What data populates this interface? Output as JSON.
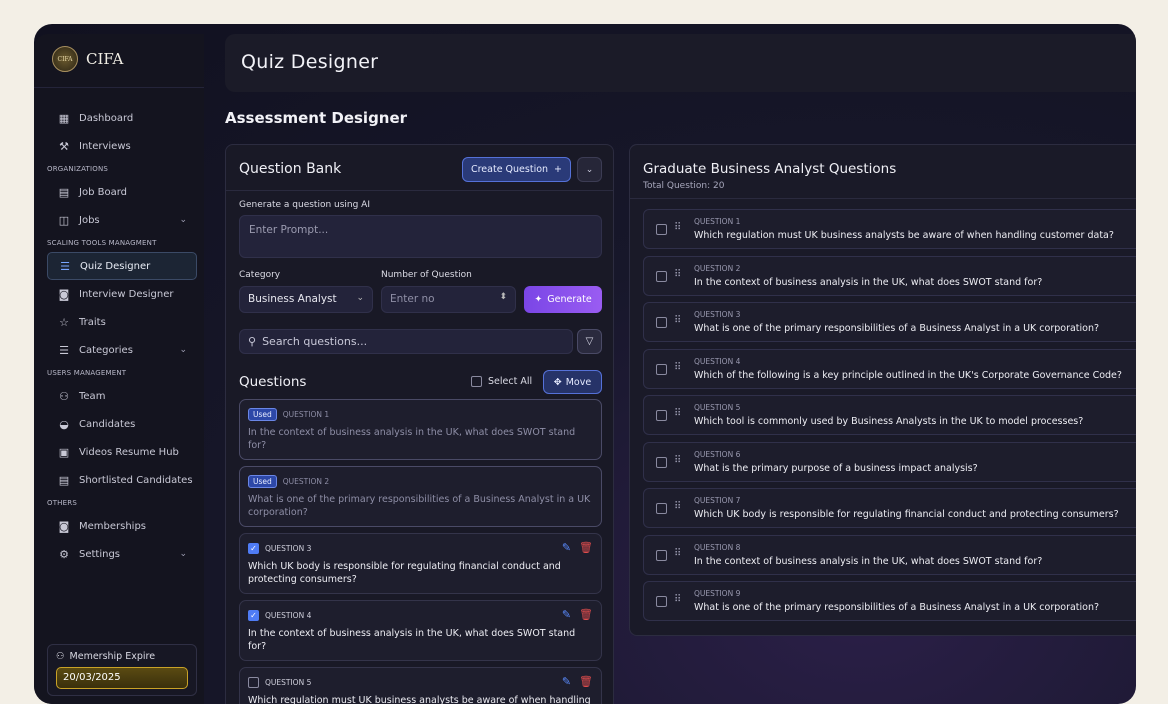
{
  "brand": {
    "logo_text": "CIFA",
    "badge_text": "CIFA"
  },
  "sidebar": {
    "items": [
      {
        "type": "item",
        "label": "Dashboard",
        "icon": "grid-icon",
        "glyph": "▦"
      },
      {
        "type": "item",
        "label": "Interviews",
        "icon": "gavel-icon",
        "glyph": "⚒"
      },
      {
        "type": "section",
        "label": "ORGANIZATIONS"
      },
      {
        "type": "item",
        "label": "Job Board",
        "icon": "board-icon",
        "glyph": "▤"
      },
      {
        "type": "item",
        "label": "Jobs",
        "icon": "briefcase-icon",
        "glyph": "◫",
        "chevron": true
      },
      {
        "type": "section",
        "label": "SCALING TOOLS MANAGMENT"
      },
      {
        "type": "item",
        "label": "Quiz Designer",
        "icon": "list-icon",
        "glyph": "☰",
        "active": true
      },
      {
        "type": "item",
        "label": "Interview Designer",
        "icon": "portrait-icon",
        "glyph": "◙"
      },
      {
        "type": "item",
        "label": "Traits",
        "icon": "star-icon",
        "glyph": "☆"
      },
      {
        "type": "item",
        "label": "Categories",
        "icon": "menu-icon",
        "glyph": "☰",
        "chevron": true
      },
      {
        "type": "section",
        "label": "USERS MANAGEMENT"
      },
      {
        "type": "item",
        "label": "Team",
        "icon": "team-icon",
        "glyph": "⚇"
      },
      {
        "type": "item",
        "label": "Candidates",
        "icon": "graduation-cap-icon",
        "glyph": "◒"
      },
      {
        "type": "item",
        "label": "Videos Resume Hub",
        "icon": "video-file-icon",
        "glyph": "▣"
      },
      {
        "type": "item",
        "label": "Shortlisted Candidates",
        "icon": "clipboard-icon",
        "glyph": "▤"
      },
      {
        "type": "section",
        "label": "OTHERS"
      },
      {
        "type": "item",
        "label": "Memberships",
        "icon": "id-card-icon",
        "glyph": "◙"
      },
      {
        "type": "item",
        "label": "Settings",
        "icon": "gear-icon",
        "glyph": "⚙",
        "chevron": true
      }
    ],
    "membership": {
      "label": "Memership Expire",
      "date": "20/03/2025"
    }
  },
  "header": {
    "title": "Quiz Designer"
  },
  "page": {
    "title": "Assessment Designer"
  },
  "question_bank": {
    "title": "Question Bank",
    "create_label": "Create Question",
    "ai_label": "Generate a question using AI",
    "prompt_placeholder": "Enter Prompt...",
    "category_label": "Category",
    "category_value": "Business Analyst",
    "number_label": "Number of Question",
    "number_placeholder": "Enter no",
    "generate_label": "Generate",
    "search_placeholder": "Search questions...",
    "questions_heading": "Questions",
    "select_all_label": "Select All",
    "move_label": "Move",
    "questions": [
      {
        "label": "QUESTION 1",
        "text": "In the context of business analysis in the UK, what does SWOT stand for?",
        "used": true,
        "checked": false
      },
      {
        "label": "QUESTION 2",
        "text": "What is one of the primary responsibilities of a Business Analyst in a UK corporation?",
        "used": true,
        "checked": false
      },
      {
        "label": "QUESTION 3",
        "text": "Which UK body is responsible for regulating financial conduct and protecting consumers?",
        "used": false,
        "checked": true
      },
      {
        "label": "QUESTION 4",
        "text": "In the context of business analysis in the UK, what does SWOT stand for?",
        "used": false,
        "checked": true
      },
      {
        "label": "QUESTION 5",
        "text": "Which regulation must UK business analysts be aware of when handling customer data?",
        "used": false,
        "checked": false
      }
    ],
    "used_badge": "Used"
  },
  "assessment": {
    "title": "Graduate Business Analyst Questions",
    "subtitle": "Total Question: 20",
    "questions": [
      {
        "label": "QUESTION 1",
        "text": "Which regulation must UK business analysts be aware of when handling customer data?"
      },
      {
        "label": "QUESTION 2",
        "text": "In the context of business analysis in the UK, what does SWOT stand for?"
      },
      {
        "label": "QUESTION 3",
        "text": "What is one of the primary responsibilities of a Business Analyst in a UK corporation?"
      },
      {
        "label": "QUESTION 4",
        "text": "Which of the following is a key principle outlined in the UK's Corporate Governance Code?"
      },
      {
        "label": "QUESTION 5",
        "text": "Which tool is commonly used by Business Analysts in the UK to model processes?"
      },
      {
        "label": "QUESTION 6",
        "text": "What is the primary purpose of a business impact analysis?"
      },
      {
        "label": "QUESTION 7",
        "text": "Which UK body is responsible for regulating financial conduct and protecting consumers?"
      },
      {
        "label": "QUESTION 8",
        "text": "In the context of business analysis in the UK, what does SWOT stand for?"
      },
      {
        "label": "QUESTION 9",
        "text": "What is one of the primary responsibilities of a Business Analyst in a UK corporation?"
      }
    ]
  },
  "colors": {
    "accent": "#5571d8",
    "generate": "#8a52ee",
    "delete": "#e24d4d",
    "membership": "#c9a227"
  }
}
